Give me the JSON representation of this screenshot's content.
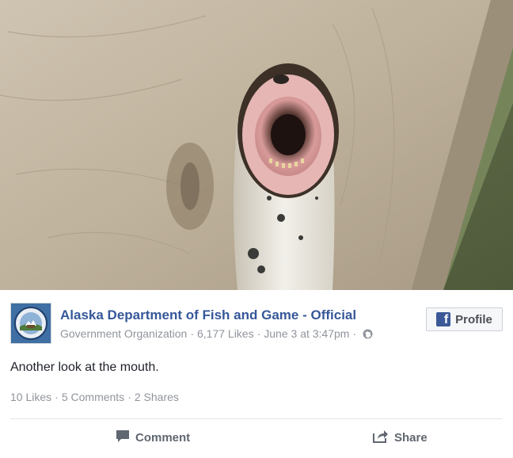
{
  "post": {
    "page_name": "Alaska Department of Fish and Game - Official",
    "category": "Government Organization",
    "likes": "6,177 Likes",
    "date": "June 3 at 3:47pm",
    "profile_button": "Profile",
    "text": "Another look at the mouth.",
    "stats": {
      "likes": "10 Likes",
      "comments": "5 Comments",
      "shares": "2 Shares"
    },
    "actions": {
      "comment": "Comment",
      "share": "Share"
    }
  },
  "icons": {
    "logo": "adfg-seal-icon",
    "globe": "globe-icon",
    "facebook": "facebook-f-icon",
    "comment": "comment-bubble-icon",
    "share": "share-arrow-icon"
  },
  "colors": {
    "link": "#365899",
    "meta": "#90949c",
    "text": "#1d2129",
    "facebook_blue": "#3b5998"
  }
}
